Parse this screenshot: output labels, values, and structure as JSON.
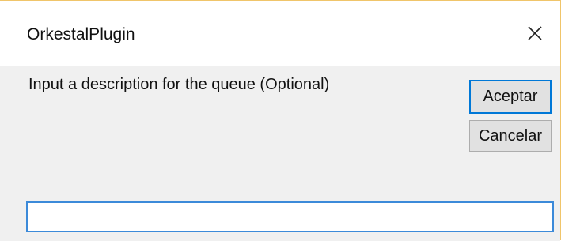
{
  "window": {
    "title": "OrkestalPlugin",
    "close_icon": "close-icon"
  },
  "dialog": {
    "prompt": "Input a description for the queue (Optional)",
    "input_value": "",
    "input_placeholder": ""
  },
  "buttons": {
    "ok_label": "Aceptar",
    "cancel_label": "Cancelar"
  },
  "colors": {
    "accent": "#0078d7",
    "window_border": "#f0c56a",
    "dialog_background": "#f0f0f0",
    "titlebar_background": "#ffffff",
    "button_face": "#e1e1e1"
  }
}
